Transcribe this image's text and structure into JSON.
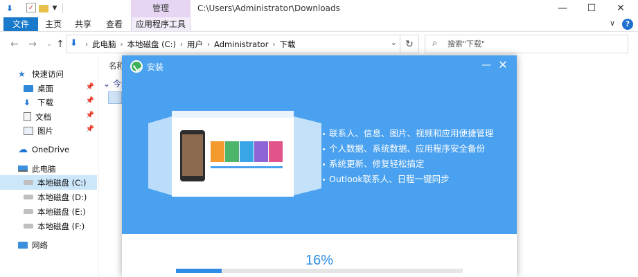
{
  "window": {
    "manage_tab": "管理",
    "path_title": "C:\\Users\\Administrator\\Downloads",
    "controls": [
      "—",
      "☐",
      "✕"
    ]
  },
  "ribbon": {
    "tabs": [
      "文件",
      "主页",
      "共享",
      "查看",
      "应用程序工具"
    ],
    "chevron": "∨",
    "help": "?"
  },
  "address": {
    "crumbs": [
      "此电脑",
      "本地磁盘 (C:)",
      "用户",
      "Administrator",
      "下载"
    ],
    "search_placeholder": "搜索\"下载\""
  },
  "sidebar": {
    "items": [
      {
        "label": "快速访问",
        "icon": "star-icon",
        "pinned": false
      },
      {
        "label": "桌面",
        "icon": "desktop-icon",
        "pinned": true
      },
      {
        "label": "下载",
        "icon": "download-icon",
        "pinned": true
      },
      {
        "label": "文档",
        "icon": "document-icon",
        "pinned": true
      },
      {
        "label": "图片",
        "icon": "pictures-icon",
        "pinned": true
      },
      {
        "label": "OneDrive",
        "icon": "cloud-icon",
        "pinned": false
      },
      {
        "label": "此电脑",
        "icon": "computer-icon",
        "pinned": false
      },
      {
        "label": "本地磁盘 (C:)",
        "icon": "drive-icon",
        "pinned": false
      },
      {
        "label": "本地磁盘 (D:)",
        "icon": "drive-icon",
        "pinned": false
      },
      {
        "label": "本地磁盘 (E:)",
        "icon": "drive-icon",
        "pinned": false
      },
      {
        "label": "本地磁盘 (F:)",
        "icon": "drive-icon",
        "pinned": false
      },
      {
        "label": "网络",
        "icon": "network-icon",
        "pinned": false
      }
    ],
    "selected_index": 7
  },
  "content": {
    "column_name": "名称",
    "group_today": "今天"
  },
  "installer": {
    "title": "安装",
    "features": [
      "联系人、信息、图片、视频和应用便捷管理",
      "个人数据、系统数据、应用程序安全备份",
      "系统更新、修复轻松搞定",
      "Outlook联系人、日程一键同步"
    ],
    "progress_text": "16%",
    "progress": 0.16,
    "min_glyph": "—",
    "close_glyph": "✕",
    "colors": {
      "header": "#4aa1ef",
      "progress": "#2f8de6"
    }
  }
}
